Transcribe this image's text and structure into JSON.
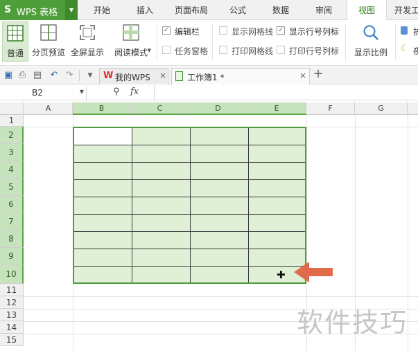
{
  "app": {
    "logo": "S",
    "name": "WPS 表格"
  },
  "menu": {
    "tabs": [
      "开始",
      "插入",
      "页面布局",
      "公式",
      "数据",
      "审阅",
      "视图",
      "开发工"
    ],
    "active": "视图"
  },
  "ribbon": {
    "normal": "普通",
    "page_preview": "分页预览",
    "fullscreen": "全屏显示",
    "reading_mode": "阅读模式",
    "edit_bar": "编辑栏",
    "task_pane": "任务窗格",
    "show_gridlines": "显示网格线",
    "print_gridlines": "打印网格线",
    "show_headers": "显示行号列标",
    "print_headers": "打印行号列标",
    "zoom": "显示比例",
    "extra_a": "护",
    "extra_b": "夜"
  },
  "tabs": {
    "home": "我的WPS",
    "doc": "工作簿1 *",
    "close": "×",
    "add": "+"
  },
  "formula": {
    "cell_ref": "B2",
    "fx": "fx"
  },
  "grid": {
    "columns": [
      "A",
      "B",
      "C",
      "D",
      "E",
      "F",
      "G"
    ],
    "rows": [
      "1",
      "2",
      "3",
      "4",
      "5",
      "6",
      "7",
      "8",
      "9",
      "10",
      "11",
      "12",
      "13",
      "14",
      "15"
    ]
  },
  "watermark": "软件技巧",
  "colors": {
    "brand": "#4e9e3a",
    "selection": "#dff0d6",
    "arrow": "#e06a4a"
  }
}
